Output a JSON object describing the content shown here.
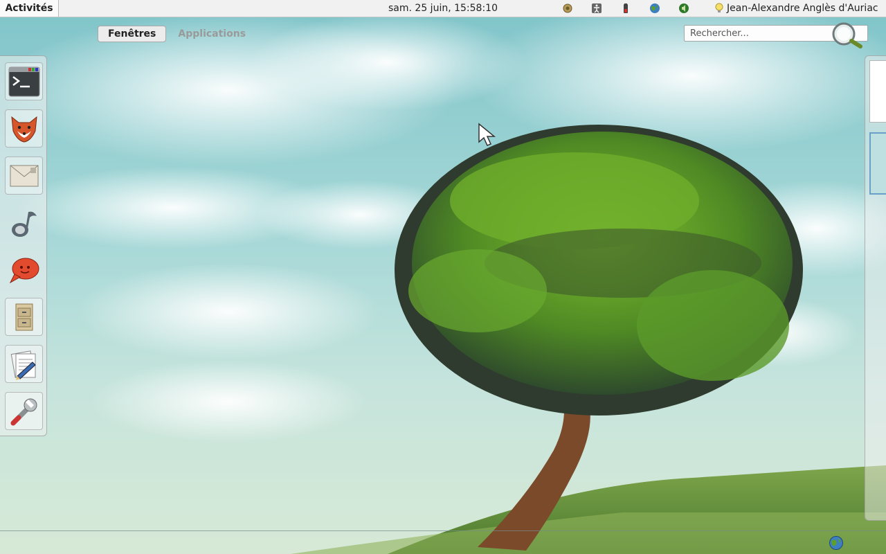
{
  "topbar": {
    "activities_label": "Activités",
    "clock": "sam. 25 juin, 15:58:10",
    "tray_icons": [
      "network-icon",
      "accessibility-icon",
      "battery-icon",
      "globe-icon",
      "volume-icon"
    ],
    "user_name": "Jean-Alexandre Anglès d'Auriac",
    "user_status_icon": "lightbulb-icon"
  },
  "overview": {
    "tabs": [
      {
        "label": "Fenêtres",
        "active": true
      },
      {
        "label": "Applications",
        "active": false
      }
    ],
    "search": {
      "placeholder": "Rechercher...",
      "value": ""
    }
  },
  "dash": {
    "items": [
      {
        "name": "terminal",
        "icon": "terminal-icon"
      },
      {
        "name": "firefox",
        "icon": "firefox-icon"
      },
      {
        "name": "mail",
        "icon": "envelope-icon"
      },
      {
        "name": "music-player",
        "icon": "music-note-icon"
      },
      {
        "name": "chat",
        "icon": "chat-bubble-icon"
      },
      {
        "name": "file-manager",
        "icon": "filing-cabinet-icon"
      },
      {
        "name": "text-editor",
        "icon": "document-pen-icon"
      },
      {
        "name": "tools",
        "icon": "wrench-icon"
      }
    ]
  },
  "colors": {
    "topbar_bg": "#f1f1f1",
    "sky": "#8ecbce",
    "tree_green": "#5a9a2a",
    "trunk": "#7a4a2a"
  }
}
